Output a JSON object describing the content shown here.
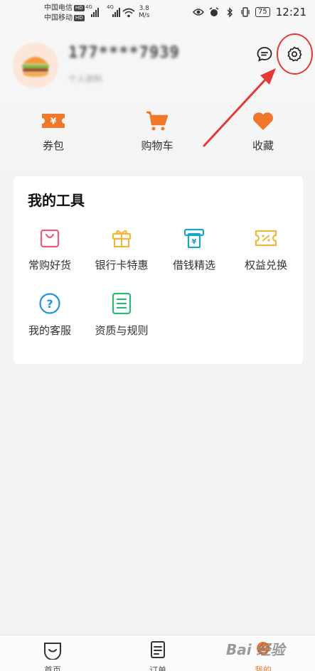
{
  "status_bar": {
    "carrier_1": "中国电信",
    "carrier_2": "中国移动",
    "hd_badge": "HD",
    "network_1": "4G",
    "network_2": "4G",
    "speed_value": "3.8",
    "speed_unit": "M/s",
    "battery": "75",
    "time": "12:21"
  },
  "profile": {
    "phone": "177****7939",
    "subtitle": "个人资料"
  },
  "quick_actions": [
    {
      "label": "券包",
      "icon": "coupon-ticket-icon"
    },
    {
      "label": "购物车",
      "icon": "shopping-cart-icon"
    },
    {
      "label": "收藏",
      "icon": "heart-icon"
    }
  ],
  "tools": {
    "title": "我的工具",
    "items": [
      {
        "label": "常购好货",
        "icon": "shopping-bag-icon"
      },
      {
        "label": "银行卡特惠",
        "icon": "gift-box-icon"
      },
      {
        "label": "借钱精选",
        "icon": "atm-yuan-icon"
      },
      {
        "label": "权益兑换",
        "icon": "percent-ticket-icon"
      },
      {
        "label": "我的客服",
        "icon": "question-circle-icon"
      },
      {
        "label": "资质与规则",
        "icon": "document-list-icon"
      }
    ]
  },
  "bottom_nav": [
    {
      "label": "首页",
      "icon": "home-smile-icon"
    },
    {
      "label": "订单",
      "icon": "order-list-icon"
    },
    {
      "label": "我的",
      "icon": "me-icon",
      "active": true
    }
  ],
  "watermark": "Bai 经验",
  "colors": {
    "accent_orange": "#f0782b",
    "annotation_red": "#e53935",
    "tool_pink": "#ee5a7a",
    "tool_yellow": "#f2b63c",
    "tool_cyan": "#1fa3c4",
    "tool_blue": "#2196d8",
    "tool_green": "#2fb773"
  }
}
